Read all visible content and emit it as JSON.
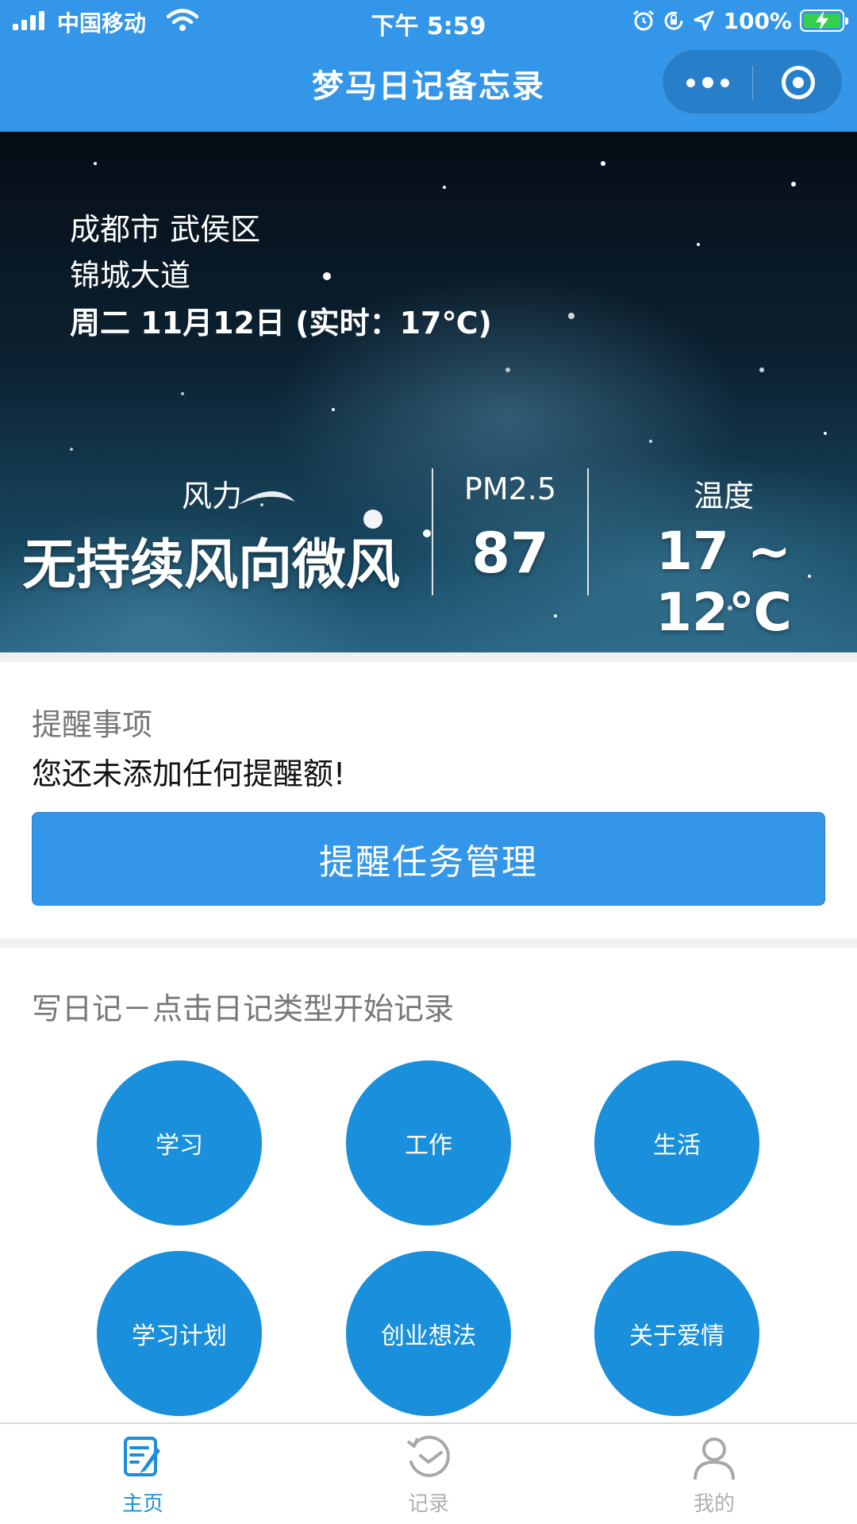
{
  "status_bar": {
    "carrier": "中国移动",
    "time": "下午 5:59",
    "battery": "100%"
  },
  "nav": {
    "title": "梦马日记备忘录"
  },
  "weather": {
    "city": "成都市 武侯区",
    "street": "锦城大道",
    "date": "周二 11月12日 (实时：17℃)",
    "wind_label": "风力",
    "wind_value": "无持续风向微风",
    "pm_label": "PM2.5",
    "pm_value": "87",
    "temp_label": "温度",
    "temp_value": "17 ~ 12℃"
  },
  "reminder": {
    "title": "提醒事项",
    "message": "您还未添加任何提醒额!",
    "button": "提醒任务管理"
  },
  "diary": {
    "title": "写日记－点击日记类型开始记录",
    "types": [
      "学习",
      "工作",
      "生活",
      "学习计划",
      "创业想法",
      "关于爱情"
    ]
  },
  "tabbar": {
    "items": [
      {
        "label": "主页",
        "icon": "edit-note-icon",
        "active": true
      },
      {
        "label": "记录",
        "icon": "history-icon",
        "active": false
      },
      {
        "label": "我的",
        "icon": "user-icon",
        "active": false
      }
    ]
  },
  "colors": {
    "primary": "#3396e8",
    "circle": "#1a8fdb",
    "tab_active": "#1a8fdb",
    "tab_inactive": "#b0b0b0"
  }
}
